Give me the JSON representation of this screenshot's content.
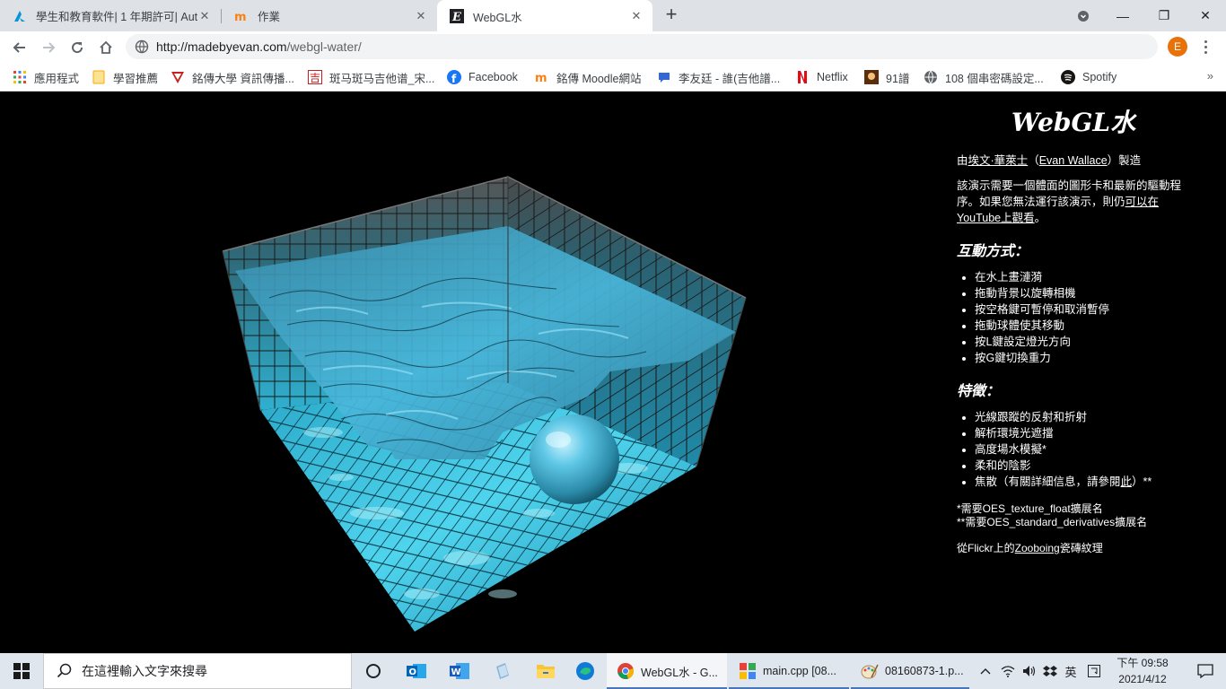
{
  "browser": {
    "tabs": [
      {
        "title": "學生和教育軟件| 1 年期許可| Aut",
        "icon": "autodesk-icon"
      },
      {
        "title": "作業",
        "icon": "moodle-icon"
      },
      {
        "title": "WebGL水",
        "icon": "evan-e-icon"
      }
    ],
    "new_tab": "+",
    "window_controls": {
      "minimize": "—",
      "restore": "❐",
      "close": "✕"
    },
    "url_host": "http://madebyevan.com",
    "url_path": "/webgl-water/",
    "profile_initial": "E",
    "bookmarks": [
      {
        "label": "應用程式",
        "icon": "apps-grid-icon"
      },
      {
        "label": "學習推薦",
        "icon": "folder-icon"
      },
      {
        "label": "銘傳大學 資訊傳播...",
        "icon": "mcu-shield-icon"
      },
      {
        "label": "斑马斑马吉他谱_宋...",
        "icon": "guitar-tab-icon"
      },
      {
        "label": "Facebook",
        "icon": "facebook-icon"
      },
      {
        "label": "銘傳 Moodle網站",
        "icon": "moodle-icon"
      },
      {
        "label": "李友廷 - 誰(吉他譜...",
        "icon": "chat-bubble-icon"
      },
      {
        "label": "Netflix",
        "icon": "netflix-icon"
      },
      {
        "label": "91譜",
        "icon": "91pu-icon"
      },
      {
        "label": "108 個串密碼設定...",
        "icon": "globe-icon"
      },
      {
        "label": "Spotify",
        "icon": "spotify-icon"
      }
    ],
    "bookmarks_more": "»"
  },
  "page": {
    "title": "WebGL水",
    "byline_prefix": "由",
    "byline_link_cn": "埃文·華萊士",
    "byline_paren_open": "（",
    "byline_link_en": "Evan Wallace",
    "byline_paren_close": "）製造",
    "intro_text": "該演示需要一個體面的圖形卡和最新的驅動程序。如果您無法運行該演示，則仍",
    "intro_link": "可以在YouTube上觀看",
    "intro_end": "。",
    "interaction_heading": "互動方式：",
    "interactions": [
      "在水上畫漣漪",
      "拖動背景以旋轉相機",
      "按空格鍵可暫停和取消暫停",
      "拖動球體使其移動",
      "按L鍵設定燈光方向",
      "按G鍵切換重力"
    ],
    "features_heading": "特徵：",
    "features": [
      "光線跟蹤的反射和折射",
      "解析環境光遮擋",
      "高度場水模擬*"
    ],
    "feature_soft_shadows": "柔和的陰影",
    "feature_caustics_prefix": "焦散（有關詳細信息，請參閱",
    "feature_caustics_link": "此",
    "feature_caustics_suffix": "）**",
    "note1": "*需要OES_texture_float擴展名",
    "note2": "**需要OES_standard_derivatives擴展名",
    "credit_prefix": "從Flickr上的",
    "credit_link": "Zooboing",
    "credit_suffix": "瓷磚紋理"
  },
  "taskbar": {
    "search_placeholder": "在這裡輸入文字來搜尋",
    "pinned": [
      "cortana-icon",
      "outlook-icon",
      "word-icon",
      "files-icon",
      "explorer-icon",
      "edge-icon"
    ],
    "apps": [
      {
        "label": "WebGL水 - G...",
        "icon": "chrome-icon"
      },
      {
        "label": "main.cpp [08...",
        "icon": "codeblocks-icon"
      },
      {
        "label": "08160873-1.p...",
        "icon": "paint-icon"
      }
    ],
    "tray_ime": "英",
    "time": "下午 09:58",
    "date": "2021/4/12"
  },
  "colors": {
    "water": "#3fb6d8",
    "tile": "#4fd4ee",
    "sphere": "#3aa8c8",
    "page_bg": "#000000"
  }
}
